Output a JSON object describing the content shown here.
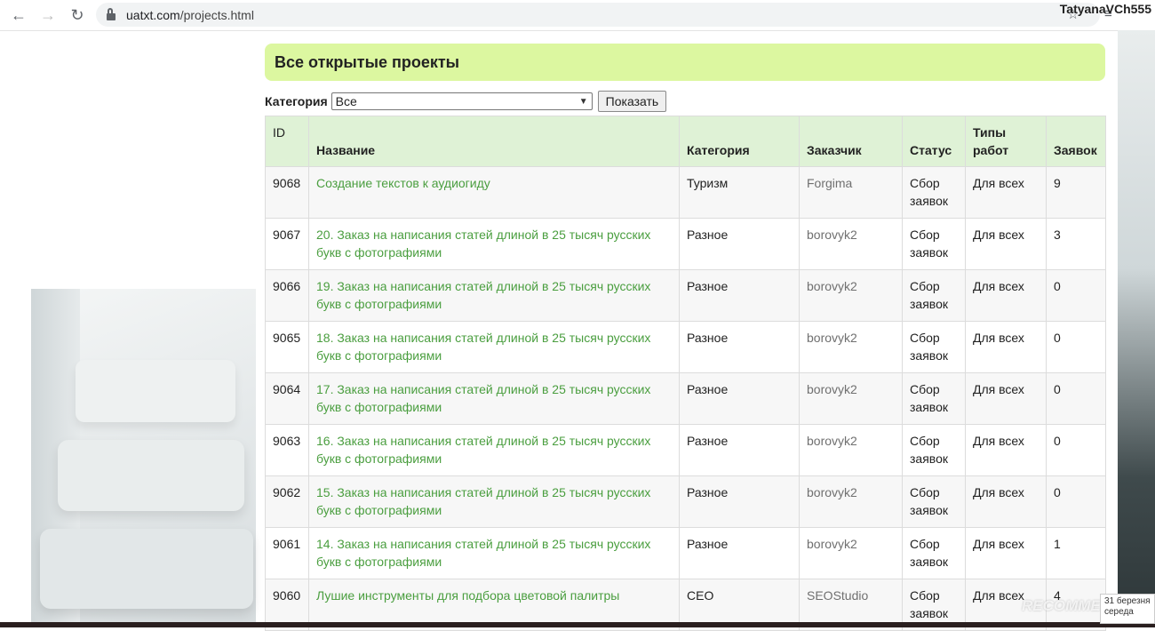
{
  "browser": {
    "url_host": "uatxt.com",
    "url_path": "/projects.html",
    "watermark_user": "TatyanaVCh555"
  },
  "page": {
    "title": "Все открытые проекты",
    "filter": {
      "label": "Категория",
      "selected": "Все",
      "button": "Показать"
    },
    "columns": [
      "ID",
      "Название",
      "Категория",
      "Заказчик",
      "Статус",
      "Типы работ",
      "Заявок"
    ],
    "rows": [
      {
        "id": "9068",
        "name": "Создание текстов к аудиогиду",
        "category": "Туризм",
        "client": "Forgima",
        "status": "Сбор заявок",
        "types": "Для всех",
        "bids": "9"
      },
      {
        "id": "9067",
        "name": "20. Заказ на написания статей длиной в 25 тысяч русских букв с фотографиями",
        "category": "Разное",
        "client": "borovyk2",
        "status": "Сбор заявок",
        "types": "Для всех",
        "bids": "3"
      },
      {
        "id": "9066",
        "name": "19. Заказ на написания статей длиной в 25 тысяч русских букв с фотографиями",
        "category": "Разное",
        "client": "borovyk2",
        "status": "Сбор заявок",
        "types": "Для всех",
        "bids": "0"
      },
      {
        "id": "9065",
        "name": "18. Заказ на написания статей длиной в 25 тысяч русских букв с фотографиями",
        "category": "Разное",
        "client": "borovyk2",
        "status": "Сбор заявок",
        "types": "Для всех",
        "bids": "0"
      },
      {
        "id": "9064",
        "name": "17. Заказ на написания статей длиной в 25 тысяч русских букв с фотографиями",
        "category": "Разное",
        "client": "borovyk2",
        "status": "Сбор заявок",
        "types": "Для всех",
        "bids": "0"
      },
      {
        "id": "9063",
        "name": "16. Заказ на написания статей длиной в 25 тысяч русских букв с фотографиями",
        "category": "Разное",
        "client": "borovyk2",
        "status": "Сбор заявок",
        "types": "Для всех",
        "bids": "0"
      },
      {
        "id": "9062",
        "name": "15. Заказ на написания статей длиной в 25 тысяч русских букв с фотографиями",
        "category": "Разное",
        "client": "borovyk2",
        "status": "Сбор заявок",
        "types": "Для всех",
        "bids": "0"
      },
      {
        "id": "9061",
        "name": "14. Заказ на написания статей длиной в 25 тысяч русских букв с фотографиями",
        "category": "Разное",
        "client": "borovyk2",
        "status": "Сбор заявок",
        "types": "Для всех",
        "bids": "1"
      },
      {
        "id": "9060",
        "name": "Лушие инструменты для подбора цветовой палитры",
        "category": "СЕО",
        "client": "SEOStudio",
        "status": "Сбор заявок",
        "types": "Для всех",
        "bids": "4"
      }
    ]
  },
  "overlay": {
    "recommend_text": "RECOMMEND.RU",
    "date_line1": "31 березня",
    "date_line2": "середа"
  },
  "colors": {
    "title_bg": "#dcf7a0",
    "header_bg": "#dff2d6",
    "link": "#4a9e3f"
  }
}
